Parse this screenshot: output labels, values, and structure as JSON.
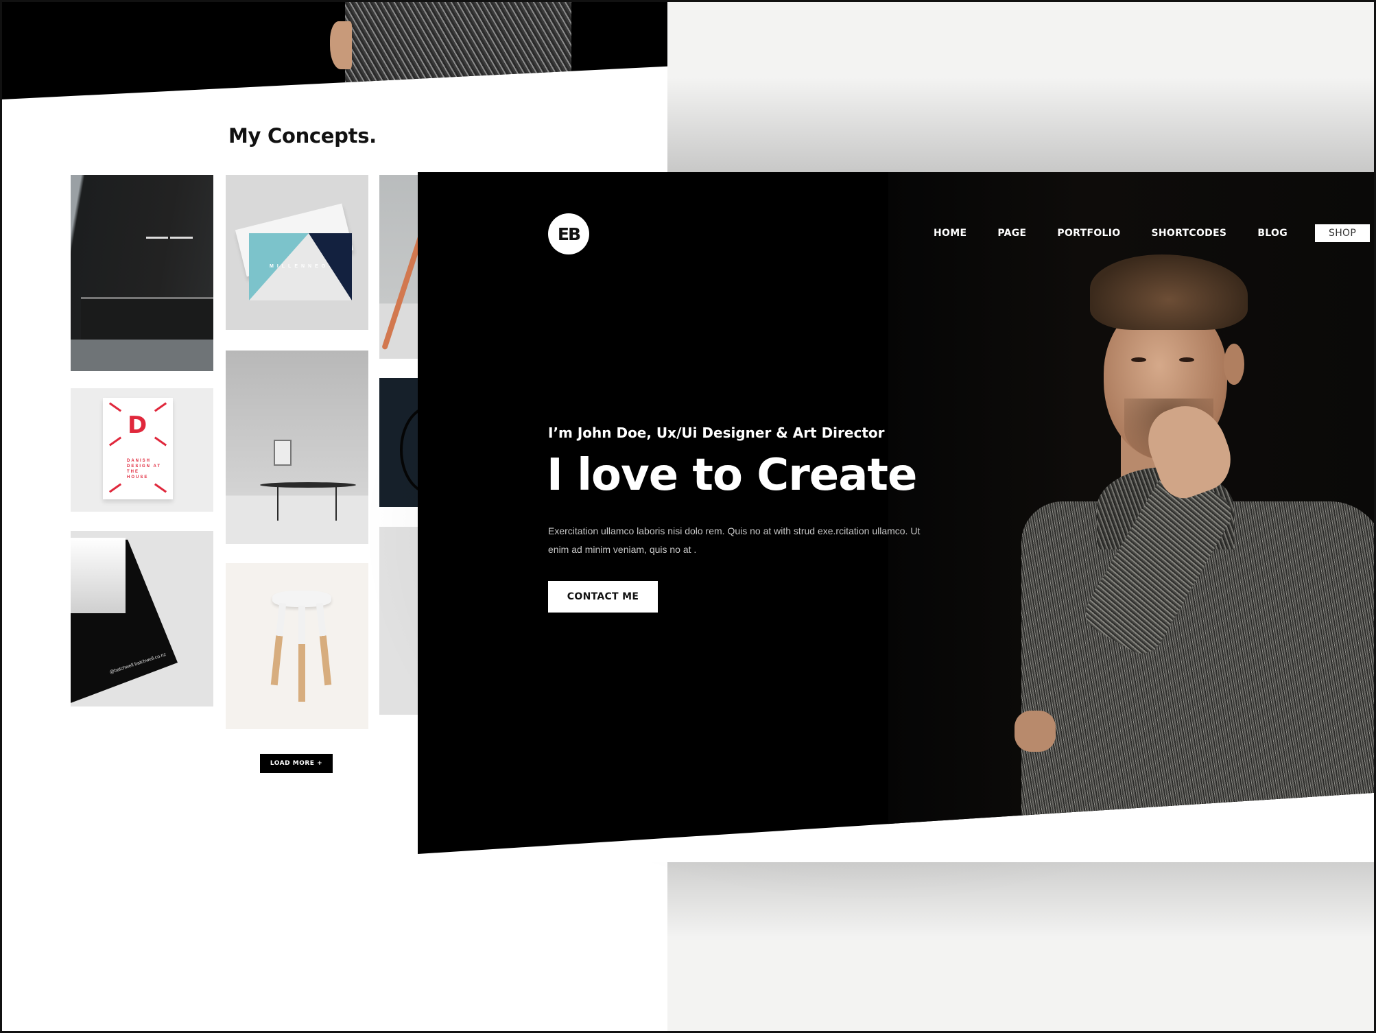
{
  "back_page": {
    "section_title": "My Concepts.",
    "load_more_label": "LOAD MORE +",
    "tiles": [
      {
        "subject": "dark minimalist kitchen"
      },
      {
        "subject": "business card mockup",
        "brand_text": "MILLENNEO"
      },
      {
        "subject": "orange chair leg"
      },
      {
        "subject": "poster",
        "letter": "D",
        "text": "DANISH DESIGN AT THE HOUSE"
      },
      {
        "subject": "minimal room with table"
      },
      {
        "subject": "bicycle"
      },
      {
        "subject": "folded black card",
        "fine_print": "@batchwell batchwell.co.nz"
      },
      {
        "subject": "white stool with wooden legs"
      },
      {
        "subject": "paper mockup"
      }
    ]
  },
  "front_page": {
    "logo_text": "EB",
    "nav": [
      {
        "label": "HOME"
      },
      {
        "label": "PAGE"
      },
      {
        "label": "PORTFOLIO"
      },
      {
        "label": "SHORTCODES"
      },
      {
        "label": "BLOG"
      },
      {
        "label": "SHOP",
        "highlighted": true
      }
    ],
    "intro": "I’m John Doe, Ux/Ui Designer & Art Director",
    "headline": "I love to Create",
    "description": "Exercitation ullamco laboris nisi dolo rem. Quis no at with strud exe.rcitation ullamco. Ut enim ad minim veniam, quis no at .",
    "cta_label": "CONTACT ME"
  },
  "colors": {
    "hero_bg": "#000000",
    "page_bg": "#ffffff",
    "side_panel": "#f3f3f2",
    "poster_red": "#e0283c",
    "card_teal": "#7cc3cb",
    "card_navy": "#13213f"
  }
}
